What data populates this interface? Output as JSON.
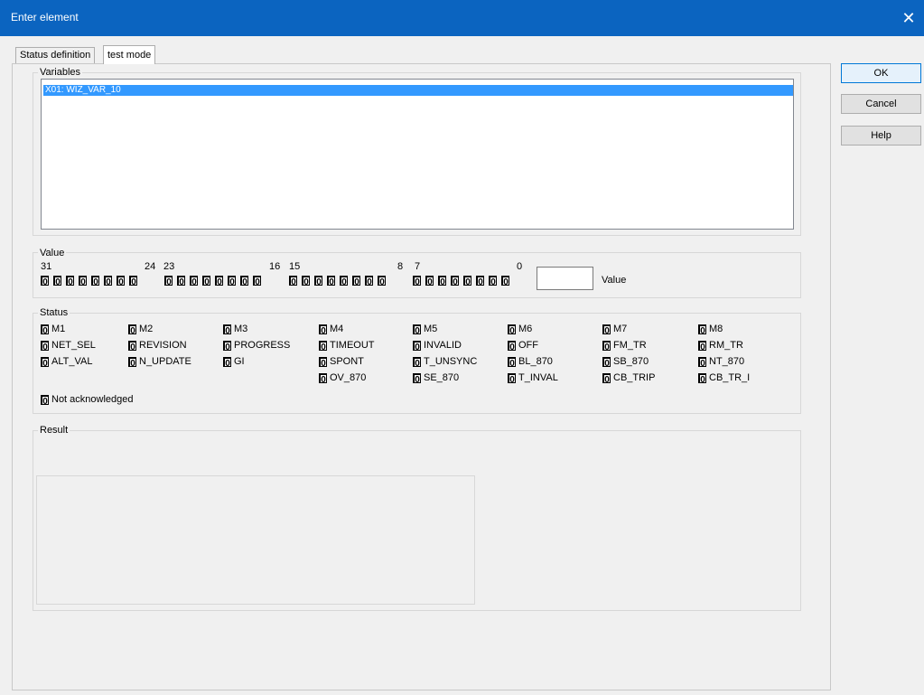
{
  "window": {
    "title": "Enter element",
    "close_glyph": "✕"
  },
  "tabs": [
    {
      "label": "Status definition",
      "active": false
    },
    {
      "label": "test mode",
      "active": true
    }
  ],
  "variables": {
    "label": "Variables",
    "items": [
      "X01: WIZ_VAR_10"
    ]
  },
  "value_group": {
    "label": "Value",
    "bit_labels": [
      "31",
      "24",
      "23",
      "16",
      "15",
      "8",
      "7",
      "0"
    ],
    "bits": [
      "0",
      "0",
      "0",
      "0",
      "0",
      "0",
      "0",
      "0",
      "0",
      "0",
      "0",
      "0",
      "0",
      "0",
      "0",
      "0",
      "0",
      "0",
      "0",
      "0",
      "0",
      "0",
      "0",
      "0",
      "0",
      "0",
      "0",
      "0",
      "0",
      "0",
      "0",
      "0"
    ],
    "value_field": "",
    "value_caption": "Value"
  },
  "status_group": {
    "label": "Status",
    "flags": [
      [
        "M1",
        "M2",
        "M3",
        "M4",
        "M5",
        "M6",
        "M7",
        "M8"
      ],
      [
        "NET_SEL",
        "REVISION",
        "PROGRESS",
        "TIMEOUT",
        "INVALID",
        "OFF",
        "FM_TR",
        "RM_TR"
      ],
      [
        "ALT_VAL",
        "N_UPDATE",
        "GI",
        "SPONT",
        "T_UNSYNC",
        "BL_870",
        "SB_870",
        "NT_870"
      ],
      [
        "",
        "",
        "",
        "OV_870",
        "SE_870",
        "T_INVAL",
        "CB_TRIP",
        "CB_TR_I"
      ]
    ],
    "flag_value": "0",
    "not_acknowledged": "Not acknowledged"
  },
  "result_group": {
    "label": "Result"
  },
  "buttons": {
    "ok": "OK",
    "cancel": "Cancel",
    "help": "Help"
  },
  "colors": {
    "titlebar": "#0b64c0",
    "selection": "#3399ff",
    "dialog_bg": "#f0f0f0"
  }
}
